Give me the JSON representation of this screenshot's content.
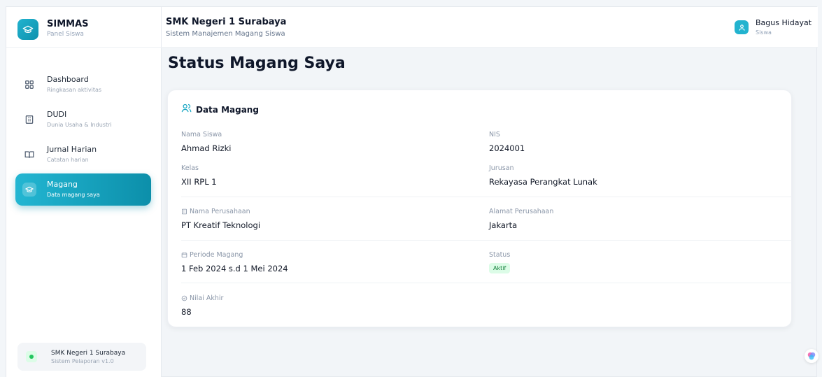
{
  "brand": {
    "title": "SIMMAS",
    "subtitle": "Panel Siswa"
  },
  "sidebar": {
    "items": [
      {
        "label": "Dashboard",
        "sub": "Ringkasan aktivitas",
        "icon": "grid-icon"
      },
      {
        "label": "DUDI",
        "sub": "Dunia Usaha & Industri",
        "icon": "building-icon"
      },
      {
        "label": "Jurnal Harian",
        "sub": "Catatan harian",
        "icon": "book-icon"
      },
      {
        "label": "Magang",
        "sub": "Data magang saya",
        "icon": "graduation-cap-icon"
      }
    ],
    "footer": {
      "title": "SMK Negeri 1 Surabaya",
      "sub": "Sistem Pelaporan v1.0"
    }
  },
  "header": {
    "school": "SMK Negeri 1 Surabaya",
    "subtitle": "Sistem Manajemen Magang Siswa",
    "user_name": "Bagus Hidayat",
    "user_role": "Siswa"
  },
  "main": {
    "title": "Status Magang Saya",
    "card_title": "Data Magang",
    "fields": {
      "nama_siswa": {
        "label": "Nama Siswa",
        "value": "Ahmad Rizki"
      },
      "nis": {
        "label": "NIS",
        "value": "2024001"
      },
      "kelas": {
        "label": "Kelas",
        "value": "XII RPL 1"
      },
      "jurusan": {
        "label": "Jurusan",
        "value": "Rekayasa Perangkat Lunak"
      },
      "nama_perusahaan": {
        "label": "Nama Perusahaan",
        "value": "PT Kreatif Teknologi"
      },
      "alamat_perusahaan": {
        "label": "Alamat Perusahaan",
        "value": "Jakarta"
      },
      "periode": {
        "label": "Periode Magang",
        "value": "1 Feb 2024 s.d 1 Mei 2024"
      },
      "status": {
        "label": "Status",
        "value": "Aktif"
      },
      "nilai": {
        "label": "Nilai Akhir",
        "value": "88"
      }
    }
  },
  "colors": {
    "accent": "#14a5c2",
    "status_bg": "#dcfce7",
    "status_text": "#15803d"
  }
}
